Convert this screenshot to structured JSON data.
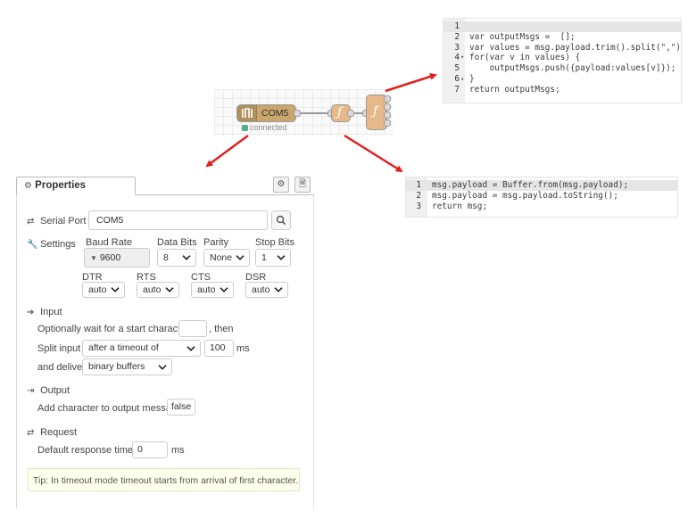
{
  "code_top": {
    "lines": [
      {
        "n": "1",
        "fold": "",
        "text": ""
      },
      {
        "n": "2",
        "fold": "",
        "text": "var outputMsgs =  [];"
      },
      {
        "n": "3",
        "fold": "",
        "text": "var values = msg.payload.trim().split(\",\");"
      },
      {
        "n": "4",
        "fold": "▾",
        "text": "for(var v in values) {"
      },
      {
        "n": "5",
        "fold": "",
        "text": "    outputMsgs.push({payload:values[v]});"
      },
      {
        "n": "6",
        "fold": "▴",
        "text": "}"
      },
      {
        "n": "7",
        "fold": "",
        "text": "return outputMsgs;"
      }
    ]
  },
  "code_bottom": {
    "lines": [
      {
        "n": "1",
        "text": "msg.payload = Buffer.from(msg.payload);"
      },
      {
        "n": "2",
        "text": "msg.payload = msg.payload.toString();"
      },
      {
        "n": "3",
        "text": "return msg;"
      }
    ]
  },
  "flow": {
    "serial_node_label": "COM5",
    "status_text": "connected",
    "status_color": "#5a8",
    "function_icon": "ƒ"
  },
  "colors": {
    "arrow": "#e02020",
    "node_orange": "#e6b88a",
    "serial_node": "#c8a66c"
  },
  "properties": {
    "tab_label": "Properties",
    "tab_icon": "gear-icon",
    "serial_port_label": "Serial Port",
    "serial_port_value": "COM5",
    "settings_label": "Settings",
    "baud_rate_label": "Baud Rate",
    "baud_rate_value": "9600",
    "data_bits_label": "Data Bits",
    "data_bits_value": "8",
    "parity_label": "Parity",
    "parity_value": "None",
    "stop_bits_label": "Stop Bits",
    "stop_bits_value": "1",
    "dtr_label": "DTR",
    "dtr_value": "auto",
    "rts_label": "RTS",
    "rts_value": "auto",
    "cts_label": "CTS",
    "cts_value": "auto",
    "dsr_label": "DSR",
    "dsr_value": "auto",
    "input_header": "Input",
    "start_char_text": "Optionally wait for a start character of",
    "start_char_value": "",
    "then_text": ", then",
    "split_input_label": "Split input",
    "split_input_value": "after a timeout of",
    "timeout_value": "100",
    "ms_unit": "ms",
    "deliver_label": "and deliver",
    "deliver_value": "binary buffers",
    "output_header": "Output",
    "add_char_text": "Add character to output messages",
    "add_char_value": "false",
    "request_header": "Request",
    "response_timeout_label": "Default response timeout",
    "response_timeout_value": "0",
    "response_ms_unit": "ms",
    "tip_text": "Tip: In timeout mode timeout starts from arrival of first character."
  }
}
